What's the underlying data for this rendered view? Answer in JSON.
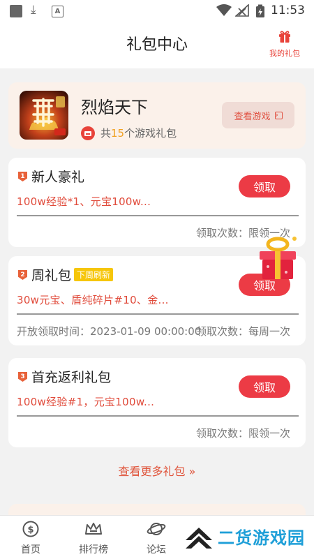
{
  "status_bar": {
    "time": "11:53"
  },
  "header": {
    "title": "礼包中心",
    "my_gifts_label": "我的礼包"
  },
  "game": {
    "name": "烈焰天下",
    "gift_count_prefix": "共",
    "gift_count": "15",
    "gift_count_suffix": "个游戏礼包",
    "view_game_label": "查看游戏"
  },
  "packs": [
    {
      "rank": "1",
      "name": "新人豪礼",
      "tag": "",
      "content": "100w经验*1、元宝100w...",
      "open_time": "",
      "limit": "领取次数：限领一次",
      "claim_label": "领取"
    },
    {
      "rank": "2",
      "name": "周礼包",
      "tag": "下周刷新",
      "content": "30w元宝、盾纯碎片#10、金...",
      "open_time": "开放领取时间：2023-01-09 00:00:00",
      "limit": "领取次数：每周一次",
      "claim_label": "领取"
    },
    {
      "rank": "3",
      "name": "首充返利礼包",
      "tag": "",
      "content": "100w经验#1，元宝100w...",
      "open_time": "",
      "limit": "领取次数：限领一次",
      "claim_label": "领取"
    }
  ],
  "more_label": "查看更多礼包",
  "more_icon": "double-chevron-right-icon",
  "tabs": [
    {
      "label": "首页",
      "icon": "coin-icon"
    },
    {
      "label": "排行榜",
      "icon": "crown-icon"
    },
    {
      "label": "论坛",
      "icon": "planet-icon"
    }
  ],
  "watermark": {
    "text": "二货游戏园"
  },
  "colors": {
    "accent": "#ec3b45",
    "gift_count": "#f0a020",
    "tag": "#f6c60a",
    "watermark": "#1e9fd8"
  }
}
